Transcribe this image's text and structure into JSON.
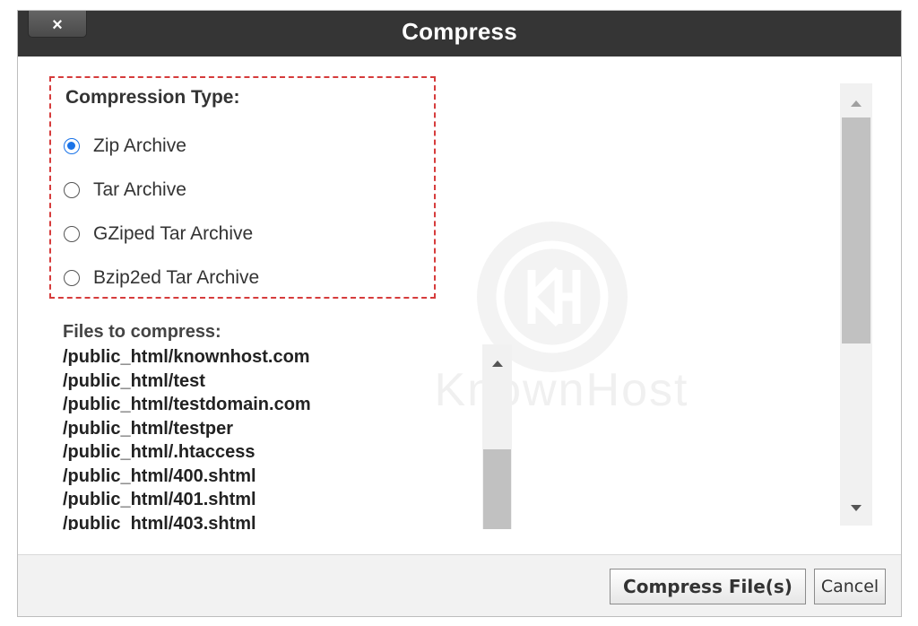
{
  "dialog": {
    "title": "Compress",
    "close_label": "×"
  },
  "compression": {
    "heading": "Compression Type:",
    "options": [
      {
        "label": "Zip Archive",
        "checked": true
      },
      {
        "label": "Tar Archive",
        "checked": false
      },
      {
        "label": "GZiped Tar Archive",
        "checked": false
      },
      {
        "label": "Bzip2ed Tar Archive",
        "checked": false
      }
    ]
  },
  "files": {
    "heading": "Files to compress:",
    "items": [
      "/public_html/knownhost.com",
      "/public_html/test",
      "/public_html/testdomain.com",
      "/public_html/testper",
      "/public_html/.htaccess",
      "/public_html/400.shtml",
      "/public_html/401.shtml",
      "/public_html/403.shtml"
    ]
  },
  "watermark": {
    "text": "KnownHost"
  },
  "footer": {
    "compress_label": "Compress File(s)",
    "cancel_label": "Cancel"
  },
  "colors": {
    "titlebar": "#353535",
    "radio_checked": "#1a73e8",
    "highlight_border": "#d63c3c"
  }
}
